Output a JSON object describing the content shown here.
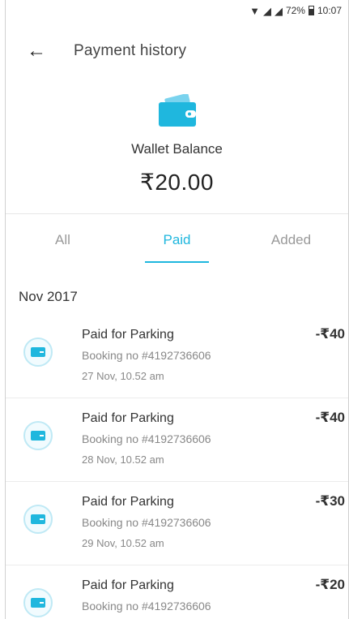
{
  "status_bar": {
    "battery": "72%",
    "time": "10:07"
  },
  "header": {
    "title": "Payment history"
  },
  "wallet": {
    "label": "Wallet Balance",
    "amount": "₹20.00"
  },
  "tabs": [
    {
      "label": "All",
      "active": false
    },
    {
      "label": "Paid",
      "active": true
    },
    {
      "label": "Added",
      "active": false
    }
  ],
  "section": {
    "title": "Nov 2017"
  },
  "transactions": [
    {
      "title": "Paid for Parking",
      "booking": "Booking no #4192736606",
      "date": "27 Nov, 10.52 am",
      "amount": "-₹40"
    },
    {
      "title": "Paid for Parking",
      "booking": "Booking no #4192736606",
      "date": "28 Nov, 10.52 am",
      "amount": "-₹40"
    },
    {
      "title": "Paid for Parking",
      "booking": "Booking no #4192736606",
      "date": "29 Nov, 10.52 am",
      "amount": "-₹30"
    },
    {
      "title": "Paid for Parking",
      "booking": "Booking no #4192736606",
      "date": "",
      "amount": "-₹20"
    }
  ],
  "colors": {
    "accent": "#1fb7de"
  }
}
